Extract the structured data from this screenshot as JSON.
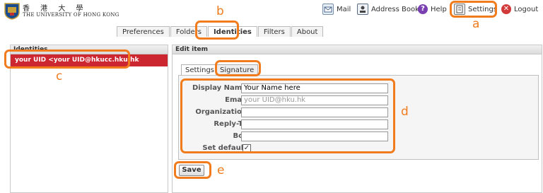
{
  "header": {
    "logo_cn": "香 港 大 學",
    "logo_en": "THE UNIVERSITY OF HONG KONG",
    "nav": [
      {
        "label": "Mail",
        "icon": "mail-icon"
      },
      {
        "label": "Address Book",
        "icon": "address-book-icon"
      },
      {
        "label": "Help",
        "icon": "help-icon"
      },
      {
        "label": "Settings",
        "icon": "settings-icon"
      },
      {
        "label": "Logout",
        "icon": "logout-icon"
      }
    ]
  },
  "tabs": [
    "Preferences",
    "Folders",
    "Identities",
    "Filters",
    "About"
  ],
  "active_tab": "Identities",
  "identities": {
    "header": "Identities",
    "selected": "your UID <your UID@hkucc.hku.hk"
  },
  "edit": {
    "header": "Edit item",
    "subtabs": [
      "Settings",
      "Signature"
    ],
    "fields": [
      {
        "label": "Display Name",
        "value": "Your Name here",
        "placeholder": ""
      },
      {
        "label": "Email",
        "value": "",
        "placeholder": "your UID@hku.hk"
      },
      {
        "label": "Organization",
        "value": "",
        "placeholder": ""
      },
      {
        "label": "Reply-To",
        "value": "",
        "placeholder": ""
      },
      {
        "label": "Bcc",
        "value": "",
        "placeholder": ""
      }
    ],
    "set_default_label": "Set default",
    "set_default_checked": "✓",
    "save_label": "Save"
  },
  "annotations": {
    "a": "a",
    "b": "b",
    "c": "c",
    "d": "d",
    "e": "e"
  },
  "colors": {
    "accent": "#f07c1e",
    "selected_row": "#cc2630"
  }
}
